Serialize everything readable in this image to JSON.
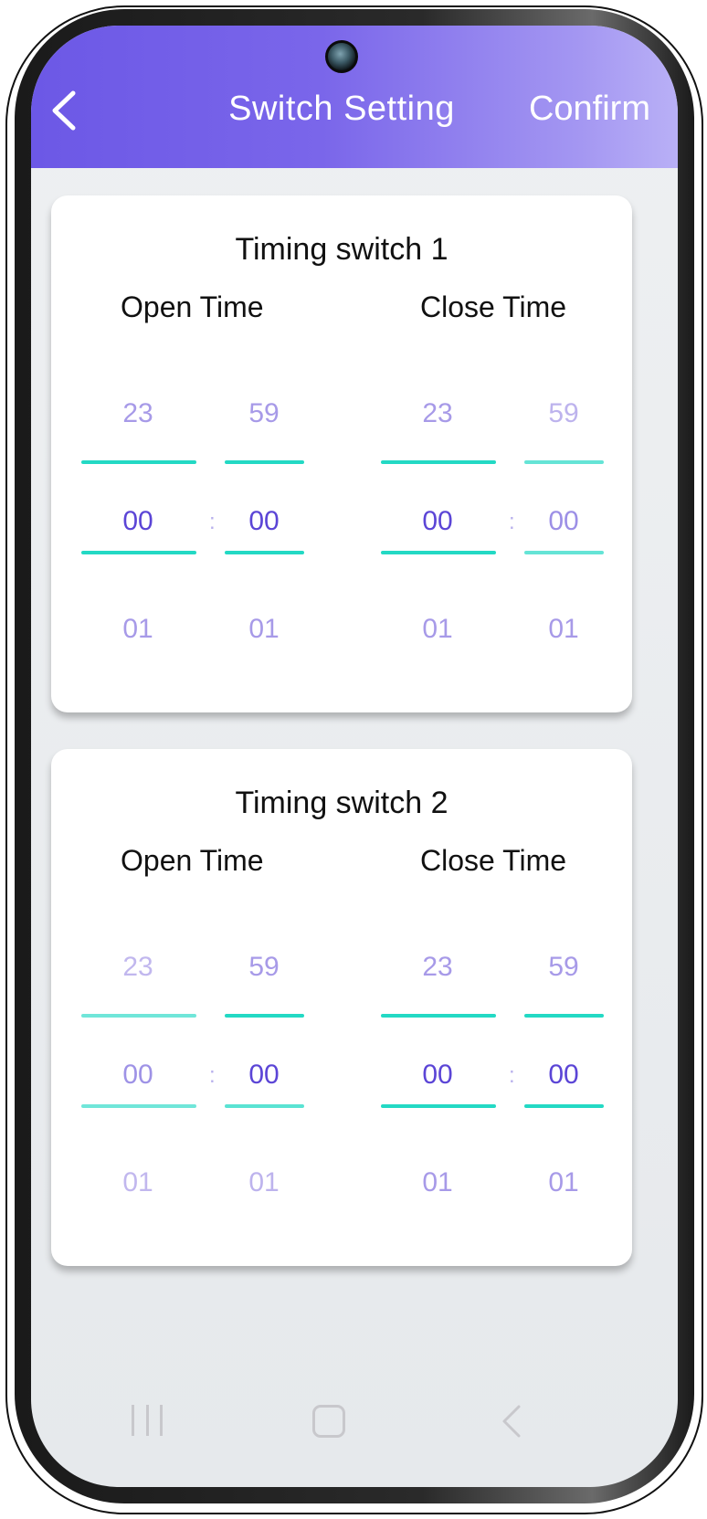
{
  "header": {
    "title": "Switch Setting",
    "confirm_label": "Confirm",
    "gradient_start": "#6c58e6",
    "gradient_end": "#b9b0f6"
  },
  "cards": [
    {
      "title": "Timing switch 1",
      "open_label": "Open Time",
      "close_label": "Close Time",
      "open_hour": {
        "prev": "23",
        "current": "00",
        "next": "01"
      },
      "open_min": {
        "prev": "59",
        "current": "00",
        "next": "01"
      },
      "close_hour": {
        "prev": "23",
        "current": "00",
        "next": "01"
      },
      "close_min": {
        "prev": "59",
        "current": "00",
        "next": "01"
      },
      "separator": ":"
    },
    {
      "title": "Timing switch 2",
      "open_label": "Open Time",
      "close_label": "Close Time",
      "open_hour": {
        "prev": "23",
        "current": "00",
        "next": "01"
      },
      "open_min": {
        "prev": "59",
        "current": "00",
        "next": "01"
      },
      "close_hour": {
        "prev": "23",
        "current": "00",
        "next": "01"
      },
      "close_min": {
        "prev": "59",
        "current": "00",
        "next": "01"
      },
      "separator": ":"
    }
  ],
  "nav": {
    "recent_icon": "recent-apps-icon",
    "home_icon": "home-icon",
    "back_icon": "back-icon"
  },
  "colors": {
    "accent_line": "#23d9c4",
    "selected_value": "#5b45d6",
    "faded_value": "#a79ae8"
  }
}
